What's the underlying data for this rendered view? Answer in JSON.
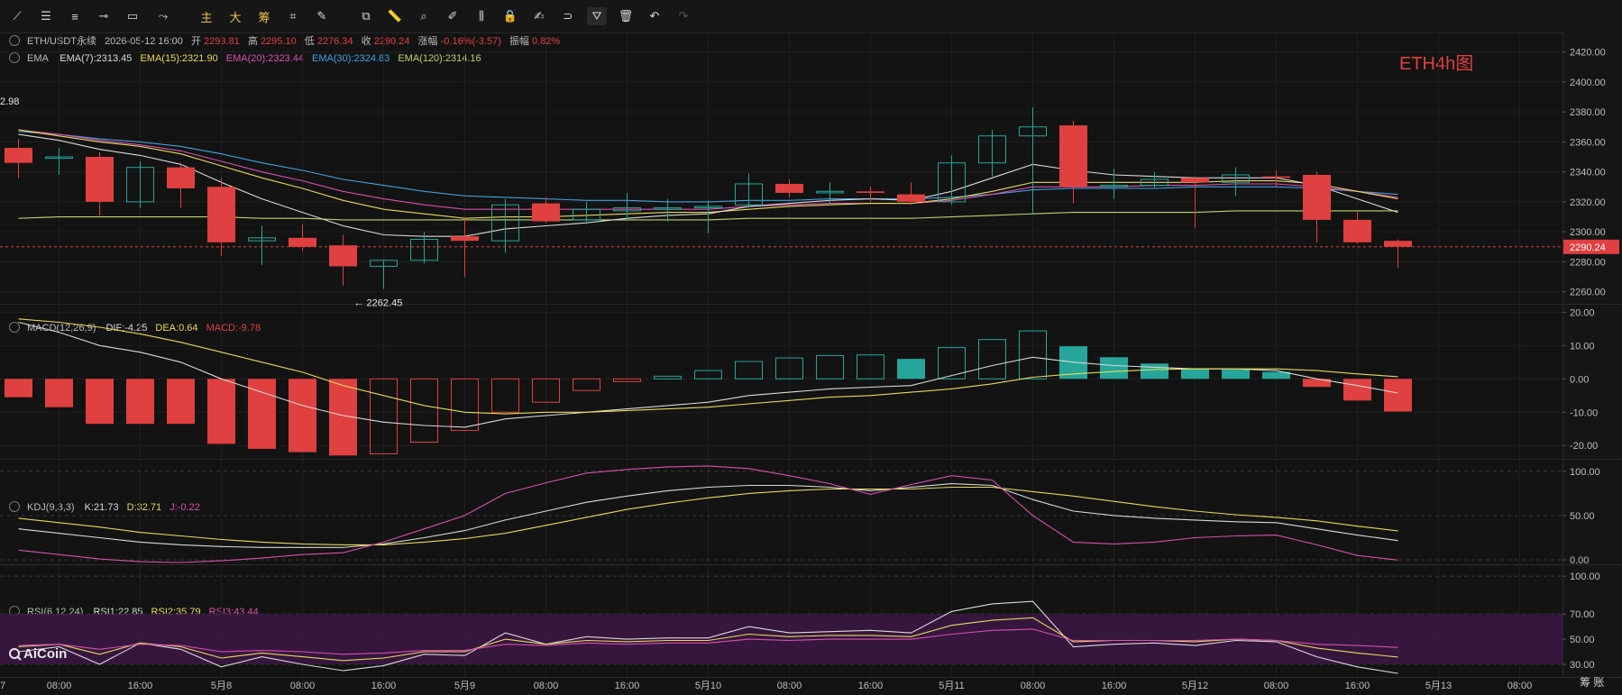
{
  "toolbar": {
    "items": [
      {
        "name": "trendline-icon",
        "glyph": "⟋"
      },
      {
        "name": "parallel-lines-icon",
        "glyph": "☰"
      },
      {
        "name": "horizontal-lines-icon",
        "glyph": "≡"
      },
      {
        "name": "horizontal-ray-icon",
        "glyph": "⊸"
      },
      {
        "name": "rectangle-icon",
        "glyph": "▭"
      },
      {
        "name": "path-icon",
        "glyph": "⤳"
      },
      {
        "name": "main-chart-button",
        "glyph": "主",
        "hl": true
      },
      {
        "name": "big-button",
        "glyph": "大",
        "hl": true
      },
      {
        "name": "chip-button",
        "glyph": "筹",
        "hl": true
      },
      {
        "name": "draw-tools-icon",
        "glyph": "⌗"
      },
      {
        "name": "brush-icon",
        "glyph": "✎"
      },
      {
        "name": "measure-icon",
        "glyph": "⧉"
      },
      {
        "name": "ruler-icon",
        "glyph": "📏"
      },
      {
        "name": "zoom-icon",
        "glyph": "⌕"
      },
      {
        "name": "pen-icon",
        "glyph": "✐"
      },
      {
        "name": "candle-pattern-icon",
        "glyph": "⫼"
      },
      {
        "name": "lock-icon",
        "glyph": "🔒"
      },
      {
        "name": "edit-note-icon",
        "glyph": "✍"
      },
      {
        "name": "magnet-icon",
        "glyph": "⊃"
      },
      {
        "name": "filter-icon",
        "glyph": "⛛"
      },
      {
        "name": "trash-icon",
        "glyph": "🗑"
      },
      {
        "name": "undo-icon",
        "glyph": "↶"
      },
      {
        "name": "redo-icon",
        "glyph": "↷",
        "dim": true
      }
    ]
  },
  "legend": {
    "symbol": "ETH/USDT永续",
    "datetime": "2026-05-12 16:00",
    "open_label": "开",
    "open": "2293.81",
    "high_label": "高",
    "high": "2295.10",
    "low_label": "低",
    "low": "2276.34",
    "close_label": "收",
    "close": "2290.24",
    "change_label": "涨幅",
    "change": "-0.16%(-3.57)",
    "amp_label": "振幅",
    "amp": "0.82%",
    "ema_title": "EMA",
    "ema7": "EMA(7):2313.45",
    "ema15": "EMA(15):2321.90",
    "ema20": "EMA(20):2323.44",
    "ema30": "EMA(30):2324.83",
    "ema120": "EMA(120):2314.16",
    "macd_title": "MACD(12,26,9)",
    "dif": "DIF:-4.25",
    "dea": "DEA:0.64",
    "macd": "MACD:-9.78",
    "kdj_title": "KDJ(9,3,3)",
    "k": "K:21.73",
    "d": "D:32.71",
    "j": "J:-0.22",
    "rsi_title": "RSI(6,12,24)",
    "rsi1": "RSI1:22.85",
    "rsi2": "RSI2:35.79",
    "rsi3": "RSI3:43.44"
  },
  "annotations": {
    "chart_label": "ETH4h图",
    "low_marker": "← 2262.45",
    "left_edge_value": "2.98",
    "last_price_tag": "2290.24",
    "logo": "AiCoin",
    "corner_label": "筹 账"
  },
  "colors": {
    "up": "#26a69a",
    "down": "#e0403f",
    "ema7": "#d9d9d9",
    "ema15": "#e8d95a",
    "ema20": "#d94fb0",
    "ema30": "#3fa2e0",
    "ema120": "#b9d66a",
    "dea": "#e8d95a",
    "rsi1": "#d9d9d9",
    "rsi2": "#e8d95a",
    "rsi3": "#d94fb0"
  },
  "chart_data": [
    {
      "type": "candlestick",
      "title": "ETH4h图",
      "y_ticks": [
        "2420.00",
        "2400.00",
        "2380.00",
        "2360.00",
        "2340.00",
        "2320.00",
        "2300.00",
        "2280.00",
        "2260.00"
      ],
      "ylim": [
        2252,
        2430
      ],
      "x_ticks": [
        {
          "i": -0.9,
          "label": "7"
        },
        {
          "i": 1,
          "label": "08:00"
        },
        {
          "i": 3,
          "label": "16:00"
        },
        {
          "i": 5,
          "label": "5月8"
        },
        {
          "i": 7,
          "label": "08:00"
        },
        {
          "i": 9,
          "label": "16:00"
        },
        {
          "i": 11,
          "label": "5月9"
        },
        {
          "i": 13,
          "label": "08:00"
        },
        {
          "i": 15,
          "label": "16:00"
        },
        {
          "i": 17,
          "label": "5月10"
        },
        {
          "i": 19,
          "label": "08:00"
        },
        {
          "i": 21,
          "label": "16:00"
        },
        {
          "i": 23,
          "label": "5月11"
        },
        {
          "i": 25,
          "label": "08:00"
        },
        {
          "i": 27,
          "label": "16:00"
        },
        {
          "i": 29,
          "label": "5月12"
        },
        {
          "i": 31,
          "label": "08:00"
        },
        {
          "i": 33,
          "label": "16:00"
        },
        {
          "i": 35,
          "label": "5月13"
        },
        {
          "i": 37,
          "label": "08:00"
        }
      ],
      "candles": [
        {
          "o": 2356,
          "h": 2362,
          "l": 2336,
          "c": 2346
        },
        {
          "o": 2349,
          "h": 2356,
          "l": 2338,
          "c": 2350
        },
        {
          "o": 2350,
          "h": 2353,
          "l": 2311,
          "c": 2320
        },
        {
          "o": 2320,
          "h": 2347,
          "l": 2316,
          "c": 2343
        },
        {
          "o": 2343,
          "h": 2346,
          "l": 2316,
          "c": 2329
        },
        {
          "o": 2330,
          "h": 2336,
          "l": 2284,
          "c": 2293
        },
        {
          "o": 2294,
          "h": 2304,
          "l": 2278,
          "c": 2296
        },
        {
          "o": 2296,
          "h": 2305,
          "l": 2287,
          "c": 2290
        },
        {
          "o": 2291,
          "h": 2298,
          "l": 2264,
          "c": 2277
        },
        {
          "o": 2277,
          "h": 2281,
          "l": 2262,
          "c": 2281
        },
        {
          "o": 2281,
          "h": 2300,
          "l": 2279,
          "c": 2295
        },
        {
          "o": 2297,
          "h": 2309,
          "l": 2270,
          "c": 2294
        },
        {
          "o": 2294,
          "h": 2322,
          "l": 2286,
          "c": 2318
        },
        {
          "o": 2319,
          "h": 2323,
          "l": 2306,
          "c": 2307
        },
        {
          "o": 2308,
          "h": 2320,
          "l": 2305,
          "c": 2315
        },
        {
          "o": 2314,
          "h": 2326,
          "l": 2308,
          "c": 2316
        },
        {
          "o": 2315,
          "h": 2322,
          "l": 2307,
          "c": 2316
        },
        {
          "o": 2316,
          "h": 2321,
          "l": 2299,
          "c": 2317
        },
        {
          "o": 2318,
          "h": 2339,
          "l": 2316,
          "c": 2332
        },
        {
          "o": 2332,
          "h": 2335,
          "l": 2323,
          "c": 2326
        },
        {
          "o": 2326,
          "h": 2333,
          "l": 2319,
          "c": 2327
        },
        {
          "o": 2327,
          "h": 2330,
          "l": 2320,
          "c": 2326
        },
        {
          "o": 2325,
          "h": 2333,
          "l": 2318,
          "c": 2320
        },
        {
          "o": 2320,
          "h": 2351,
          "l": 2318,
          "c": 2346
        },
        {
          "o": 2346,
          "h": 2368,
          "l": 2337,
          "c": 2364
        },
        {
          "o": 2364,
          "h": 2383,
          "l": 2312,
          "c": 2370
        },
        {
          "o": 2371,
          "h": 2374,
          "l": 2319,
          "c": 2330
        },
        {
          "o": 2330,
          "h": 2342,
          "l": 2322,
          "c": 2331
        },
        {
          "o": 2331,
          "h": 2340,
          "l": 2329,
          "c": 2335
        },
        {
          "o": 2336,
          "h": 2337,
          "l": 2303,
          "c": 2333
        },
        {
          "o": 2333,
          "h": 2343,
          "l": 2324,
          "c": 2338
        },
        {
          "o": 2337,
          "h": 2341,
          "l": 2330,
          "c": 2336
        },
        {
          "o": 2338,
          "h": 2340,
          "l": 2293,
          "c": 2308
        },
        {
          "o": 2308,
          "h": 2313,
          "l": 2292,
          "c": 2293
        },
        {
          "o": 2294,
          "h": 2295,
          "l": 2276,
          "c": 2290
        }
      ],
      "ema7": [
        2365,
        2361,
        2355,
        2351,
        2345,
        2333,
        2322,
        2313,
        2304,
        2298,
        2297,
        2297,
        2302,
        2304,
        2306,
        2309,
        2311,
        2312,
        2317,
        2319,
        2321,
        2322,
        2321,
        2327,
        2336,
        2345,
        2341,
        2338,
        2337,
        2336,
        2336,
        2336,
        2331,
        2322,
        2313
      ],
      "ema15": [
        2368,
        2364,
        2360,
        2357,
        2352,
        2344,
        2336,
        2329,
        2321,
        2315,
        2312,
        2309,
        2310,
        2310,
        2311,
        2312,
        2313,
        2313,
        2315,
        2317,
        2318,
        2319,
        2319,
        2322,
        2327,
        2333,
        2333,
        2333,
        2333,
        2333,
        2334,
        2334,
        2332,
        2327,
        2322
      ],
      "ema20": [
        2368,
        2365,
        2361,
        2358,
        2354,
        2347,
        2340,
        2334,
        2327,
        2322,
        2318,
        2315,
        2315,
        2315,
        2315,
        2315,
        2315,
        2315,
        2317,
        2318,
        2319,
        2319,
        2319,
        2321,
        2325,
        2330,
        2330,
        2330,
        2331,
        2331,
        2332,
        2332,
        2330,
        2327,
        2323
      ],
      "ema30": [
        2367,
        2365,
        2362,
        2360,
        2357,
        2352,
        2346,
        2341,
        2335,
        2331,
        2327,
        2324,
        2323,
        2322,
        2321,
        2321,
        2320,
        2320,
        2321,
        2321,
        2322,
        2322,
        2322,
        2323,
        2325,
        2328,
        2329,
        2329,
        2329,
        2330,
        2330,
        2330,
        2329,
        2327,
        2325
      ],
      "ema120": [
        2309,
        2310,
        2310,
        2310,
        2310,
        2310,
        2309,
        2309,
        2308,
        2308,
        2308,
        2308,
        2308,
        2308,
        2308,
        2308,
        2308,
        2308,
        2309,
        2309,
        2309,
        2309,
        2309,
        2310,
        2311,
        2312,
        2313,
        2313,
        2313,
        2313,
        2314,
        2314,
        2314,
        2314,
        2314
      ]
    },
    {
      "type": "bar",
      "title": "MACD(12,26,9)",
      "y_ticks": [
        "20.00",
        "10.00",
        "0.00",
        "-10.00",
        "-20.00"
      ],
      "ylim": [
        -24,
        22
      ],
      "macd": [
        -5.5,
        -8.5,
        -13.5,
        -13.5,
        -13.5,
        -19.5,
        -21,
        -22,
        -23,
        -22.5,
        -19,
        -15.5,
        -10,
        -7,
        -3.5,
        -0.8,
        0.8,
        2.5,
        5.2,
        6.3,
        7,
        7.2,
        6,
        9.4,
        11.8,
        14.4,
        9.8,
        6.5,
        4.6,
        3.1,
        2.8,
        2.1,
        -2.4,
        -6.5,
        -9.8
      ],
      "dif": [
        17,
        14,
        10,
        8,
        5,
        0,
        -4,
        -8,
        -11,
        -13,
        -14,
        -14.5,
        -12,
        -11,
        -10,
        -9,
        -8,
        -7,
        -5,
        -4,
        -3,
        -2.5,
        -2,
        1,
        4,
        6.5,
        5,
        4,
        3.5,
        3,
        3,
        2.5,
        0,
        -2,
        -4.25
      ],
      "dea": [
        18,
        17,
        15.5,
        13.5,
        11,
        8,
        5,
        2,
        -2,
        -5,
        -8,
        -10,
        -10.5,
        -10,
        -10,
        -9.5,
        -9,
        -8.5,
        -7.5,
        -6.5,
        -5.5,
        -5,
        -4,
        -3,
        -1.5,
        0.5,
        1.5,
        2.2,
        2.8,
        3,
        3,
        3,
        2.5,
        1.5,
        0.64
      ]
    },
    {
      "type": "line",
      "title": "KDJ(9,3,3)",
      "y_ticks": [
        "100.00",
        "50.00",
        "0.00"
      ],
      "ylim": [
        -5,
        112
      ],
      "k": [
        35,
        30,
        25,
        20,
        17,
        15,
        14,
        14,
        14,
        18,
        25,
        33,
        45,
        55,
        65,
        72,
        78,
        82,
        84,
        84,
        82,
        78,
        82,
        86,
        84,
        68,
        55,
        50,
        47,
        45,
        43,
        42,
        35,
        28,
        21.73
      ],
      "d": [
        47,
        42,
        37,
        31,
        27,
        23,
        20,
        18,
        17,
        17,
        20,
        24,
        30,
        39,
        48,
        57,
        64,
        70,
        75,
        78,
        80,
        80,
        80,
        82,
        82,
        77,
        72,
        66,
        60,
        55,
        51,
        48,
        44,
        38,
        32.71
      ],
      "j": [
        11,
        6,
        1,
        -2,
        -3,
        -1,
        2,
        6,
        8,
        20,
        35,
        50,
        75,
        87,
        98,
        102,
        105,
        106,
        103,
        95,
        86,
        74,
        85,
        95,
        90,
        50,
        20,
        18,
        20,
        25,
        27,
        28,
        17,
        5,
        -0.22
      ]
    },
    {
      "type": "line",
      "title": "RSI(6,12,24)",
      "y_ticks": [
        "100.00",
        "70.00",
        "50.00",
        "30.00"
      ],
      "ylim": [
        20,
        108
      ],
      "rsi1": [
        40,
        44,
        30,
        47,
        42,
        28,
        36,
        30,
        25,
        29,
        38,
        37,
        55,
        46,
        52,
        50,
        51,
        51,
        60,
        55,
        56,
        57,
        55,
        72,
        78,
        80,
        44,
        46,
        47,
        45,
        49,
        48,
        36,
        28,
        22.85
      ],
      "rsi2": [
        44,
        46,
        38,
        47,
        44,
        35,
        39,
        36,
        33,
        35,
        40,
        40,
        50,
        46,
        49,
        48,
        49,
        49,
        54,
        52,
        53,
        53,
        52,
        61,
        65,
        67,
        48,
        49,
        49,
        48,
        50,
        49,
        43,
        39,
        35.79
      ],
      "rsi3": [
        45,
        46,
        42,
        46,
        45,
        40,
        41,
        40,
        38,
        39,
        41,
        41,
        46,
        45,
        47,
        46,
        47,
        47,
        50,
        49,
        50,
        50,
        50,
        54,
        57,
        58,
        49,
        49,
        49,
        49,
        50,
        49,
        46,
        45,
        43.44
      ]
    }
  ]
}
